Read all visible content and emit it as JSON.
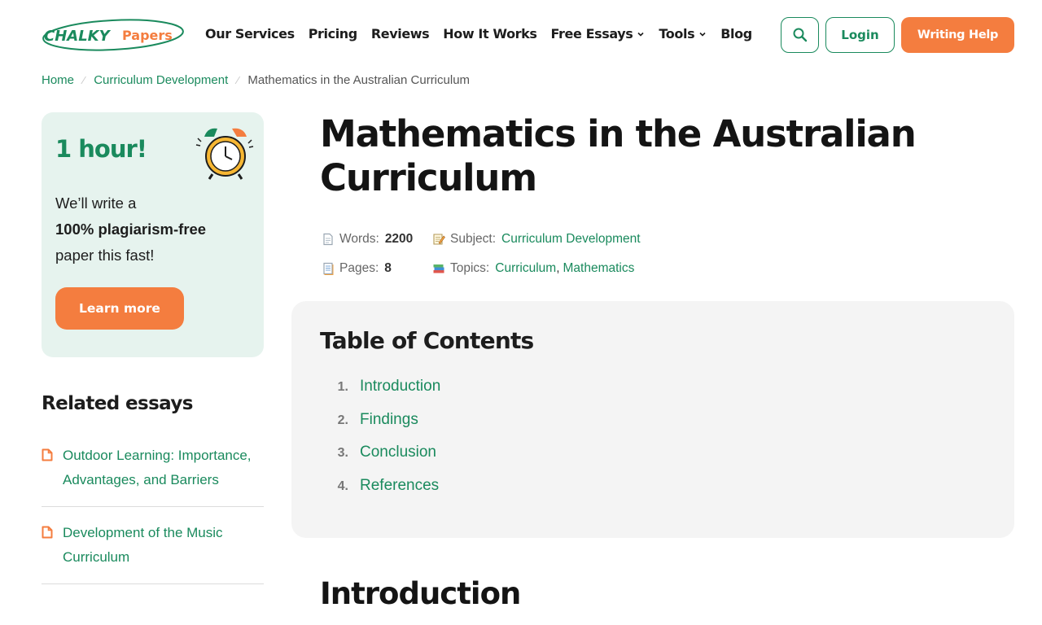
{
  "header": {
    "logo_left": "CHALKY",
    "logo_right": "Papers",
    "nav": [
      {
        "label": "Our Services",
        "dropdown": false
      },
      {
        "label": "Pricing",
        "dropdown": false
      },
      {
        "label": "Reviews",
        "dropdown": false
      },
      {
        "label": "How It Works",
        "dropdown": false
      },
      {
        "label": "Free Essays",
        "dropdown": true
      },
      {
        "label": "Tools",
        "dropdown": true
      },
      {
        "label": "Blog",
        "dropdown": false
      }
    ],
    "login_label": "Login",
    "help_label": "Writing Help"
  },
  "breadcrumb": {
    "home": "Home",
    "category": "Curriculum Development",
    "current": "Mathematics in the Australian Curriculum"
  },
  "promo": {
    "title": "1 hour!",
    "line1": "We’ll write a",
    "line2": "100% plagiarism-free",
    "line3": "paper this fast!",
    "button": "Learn more"
  },
  "related": {
    "title": "Related essays",
    "items": [
      "Outdoor Learning: Importance, Advantages, and Barriers",
      "Development of the Music Curriculum"
    ]
  },
  "article": {
    "title": "Mathematics in the Australian Curriculum",
    "words_label": "Words:",
    "words_value": "2200",
    "pages_label": "Pages:",
    "pages_value": "8",
    "subject_label": "Subject:",
    "subject_value": "Curriculum Development",
    "topics_label": "Topics:",
    "topic_1": "Curriculum",
    "topic_sep": ",",
    "topic_2": "Mathematics"
  },
  "toc": {
    "title": "Table of Contents",
    "items": [
      {
        "num": "1.",
        "label": "Introduction"
      },
      {
        "num": "2.",
        "label": "Findings"
      },
      {
        "num": "3.",
        "label": "Conclusion"
      },
      {
        "num": "4.",
        "label": "References"
      }
    ]
  },
  "section": {
    "title": "Introduction"
  },
  "colors": {
    "brand_green": "#1a8a5d",
    "accent_orange": "#f47d3f",
    "promo_bg": "#e6f3ee",
    "toc_bg": "#f4f4f4"
  },
  "icons": {
    "search": "search-icon",
    "chevron": "chevron-down-icon",
    "doc": "document-icon",
    "clock": "alarm-clock-icon"
  }
}
